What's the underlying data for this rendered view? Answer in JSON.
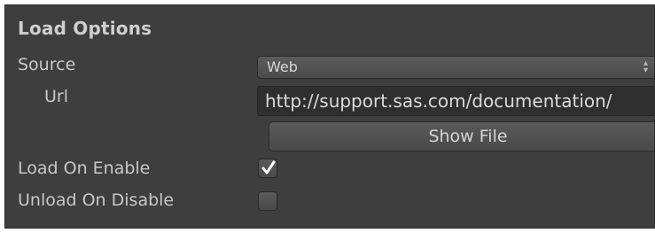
{
  "header": {
    "title": "Load Options"
  },
  "source": {
    "label": "Source",
    "selected": "Web"
  },
  "url": {
    "label": "Url",
    "value": "http://support.sas.com/documentation/"
  },
  "show_file": {
    "label": "Show File"
  },
  "load_on_enable": {
    "label": "Load On Enable",
    "checked": true
  },
  "unload_on_disable": {
    "label": "Unload On Disable",
    "checked": false
  },
  "icons": {
    "dropdown_arrow": "updown-arrows-icon",
    "checkmark": "checkmark-icon"
  },
  "colors": {
    "panel_bg": "#3e3e3e",
    "text": "#c8c8c8",
    "field_bg": "#2f2f2f"
  }
}
